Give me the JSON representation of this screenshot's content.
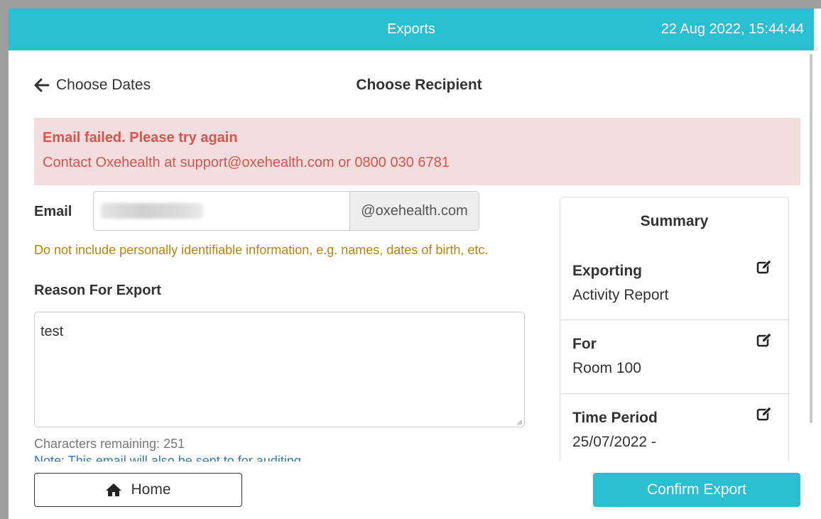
{
  "header": {
    "title": "Exports",
    "timestamp": "22 Aug 2022, 15:44:44"
  },
  "nav": {
    "back_label": "Choose Dates",
    "back_icon": "arrow-left-icon",
    "step_title": "Choose Recipient"
  },
  "alert": {
    "title": "Email failed. Please try again",
    "body": "Contact Oxehealth at support@oxehealth.com or 0800 030 6781"
  },
  "form": {
    "email_label": "Email",
    "email_value": "",
    "email_suffix": "@oxehealth.com",
    "pii_warning": "Do not include personally identifiable information, e.g. names, dates of birth, etc.",
    "reason_label": "Reason For Export",
    "reason_value": "test",
    "chars_remaining": "Characters remaining: 251",
    "note": "Note: This email will also be sent to for auditing"
  },
  "summary": {
    "title": "Summary",
    "sections": [
      {
        "label": "Exporting",
        "value": "Activity Report"
      },
      {
        "label": "For",
        "value": "Room 100"
      },
      {
        "label": "Time Period",
        "value": "25/07/2022 -"
      }
    ],
    "edit_icon": "edit-icon"
  },
  "footer": {
    "home_label": "Home",
    "home_icon": "home-icon",
    "confirm_label": "Confirm Export"
  },
  "colors": {
    "accent": "#29bfd3",
    "alert_bg": "#f2dede",
    "alert_text": "#d9534f",
    "warning_text": "#b8860b"
  }
}
